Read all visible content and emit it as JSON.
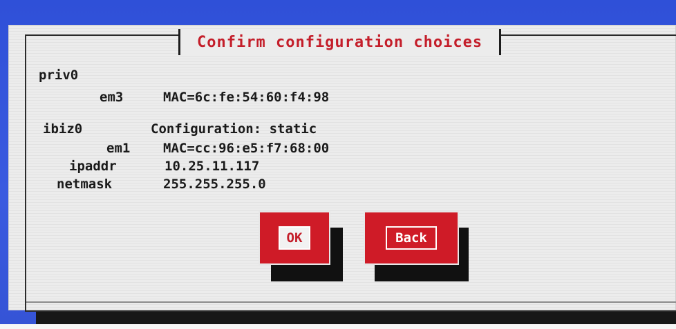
{
  "dialog": {
    "title": "Confirm configuration choices"
  },
  "interfaces": {
    "priv0": {
      "name": "priv0",
      "nic_label": "em3",
      "nic_mac": "MAC=6c:fe:54:60:f4:98"
    },
    "ibiz0": {
      "name": "ibiz0",
      "config": "Configuration: static",
      "nic_label": "em1",
      "nic_mac": "MAC=cc:96:e5:f7:68:00",
      "ipaddr_label": "ipaddr",
      "ipaddr_value": "10.25.11.117",
      "netmask_label": "netmask",
      "netmask_value": "255.255.255.0"
    }
  },
  "buttons": {
    "ok_label": "OK",
    "back_label": "Back"
  },
  "colors": {
    "accent": "#cf1b27",
    "background": "#3a5ae0",
    "title": "#c41e2a"
  }
}
